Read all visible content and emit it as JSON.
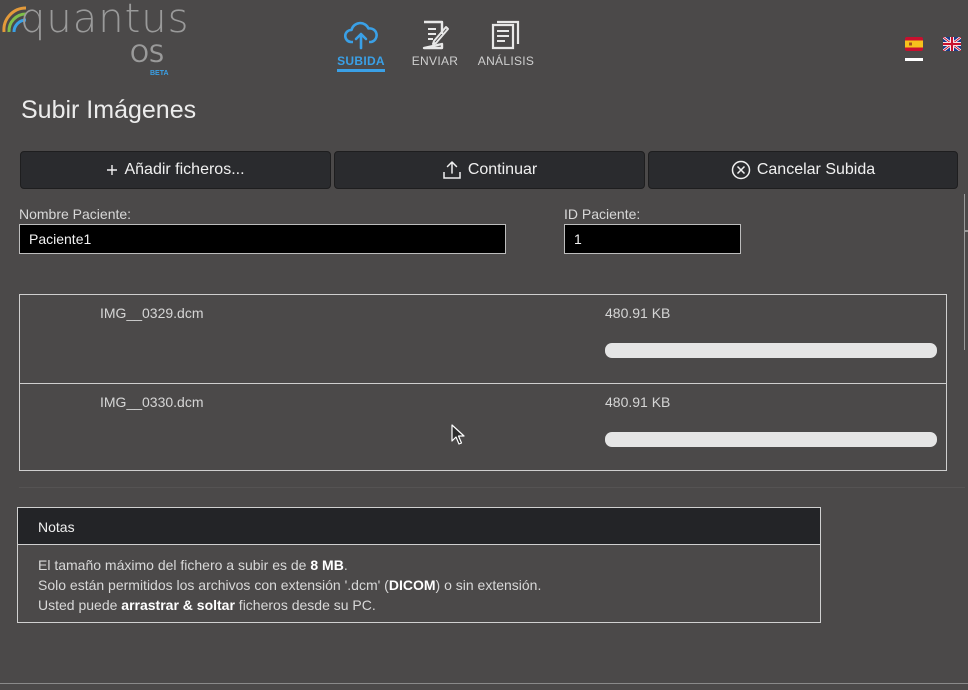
{
  "app": {
    "logo_text": "quantus",
    "logo_sub": "OS",
    "logo_badge": "BETA"
  },
  "nav": {
    "items": [
      {
        "label": "SUBIDA",
        "icon": "cloud-upload-icon",
        "active": true
      },
      {
        "label": "ENVIAR",
        "icon": "send-document-icon",
        "active": false
      },
      {
        "label": "ANÁLISIS",
        "icon": "analysis-document-icon",
        "active": false
      }
    ],
    "accent": "#3aa0e6"
  },
  "languages": [
    {
      "code": "es",
      "icon": "spain-flag-icon",
      "selected": true
    },
    {
      "code": "en",
      "icon": "uk-flag-icon",
      "selected": false
    }
  ],
  "page": {
    "title": "Subir Imágenes"
  },
  "toolbar": {
    "add_label": "Añadir ficheros...",
    "add_icon": "plus-icon",
    "continue_label": "Continuar",
    "continue_icon": "upload-icon",
    "cancel_label": "Cancelar Subida",
    "cancel_icon": "circle-x-icon"
  },
  "form": {
    "patient_name_label": "Nombre Paciente:",
    "patient_name_value": "Paciente1",
    "patient_id_label": "ID Paciente:",
    "patient_id_value": "1"
  },
  "files": [
    {
      "name": "IMG__0329.dcm",
      "size": "480.91 KB",
      "progress": 0
    },
    {
      "name": "IMG__0330.dcm",
      "size": "480.91 KB",
      "progress": 0
    }
  ],
  "notes": {
    "title": "Notas",
    "line1_pre": "El tamaño máximo del fichero a subir es de ",
    "line1_bold": "8 MB",
    "line1_post": ".",
    "line2_pre": "Solo están permitidos los archivos con extensión '.dcm' (",
    "line2_bold": "DICOM",
    "line2_post": ") o sin extensión.",
    "line3_pre": "Usted puede ",
    "line3_bold": "arrastrar & soltar",
    "line3_post": " ficheros desde su PC."
  }
}
